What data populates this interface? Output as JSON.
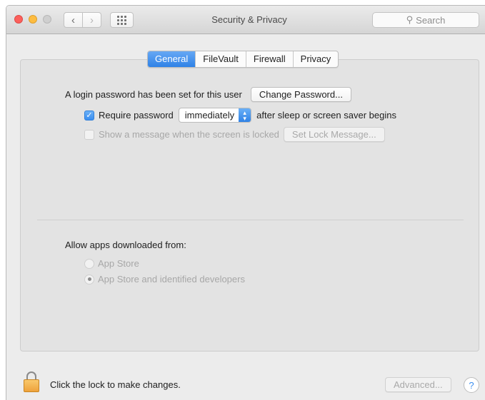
{
  "window": {
    "title": "Security & Privacy",
    "search_placeholder": "Search",
    "nav_back": "‹",
    "nav_forward": "›"
  },
  "tabs": [
    {
      "label": "General",
      "active": true
    },
    {
      "label": "FileVault",
      "active": false
    },
    {
      "label": "Firewall",
      "active": false
    },
    {
      "label": "Privacy",
      "active": false
    }
  ],
  "general": {
    "login_text": "A login password has been set for this user",
    "change_password_label": "Change Password...",
    "require_password": {
      "checked": true,
      "label": "Require password",
      "select_value": "immediately",
      "suffix": "after sleep or screen saver begins"
    },
    "show_message": {
      "checked": false,
      "label": "Show a message when the screen is locked",
      "button_label": "Set Lock Message..."
    }
  },
  "allow_apps": {
    "heading": "Allow apps downloaded from:",
    "options": [
      {
        "label": "App Store",
        "selected": false
      },
      {
        "label": "App Store and identified developers",
        "selected": true
      }
    ]
  },
  "footer": {
    "lock_text": "Click the lock to make changes.",
    "advanced_label": "Advanced...",
    "help_label": "?"
  },
  "colors": {
    "accent": "#3a8ef0",
    "close": "#fc605c",
    "minimize": "#fdbc40",
    "zoom": "#cfcfcf",
    "lock": "#eea23b"
  },
  "icons": {
    "search": "magnifying-glass",
    "lock": "padlock",
    "grid": "app-grid"
  }
}
